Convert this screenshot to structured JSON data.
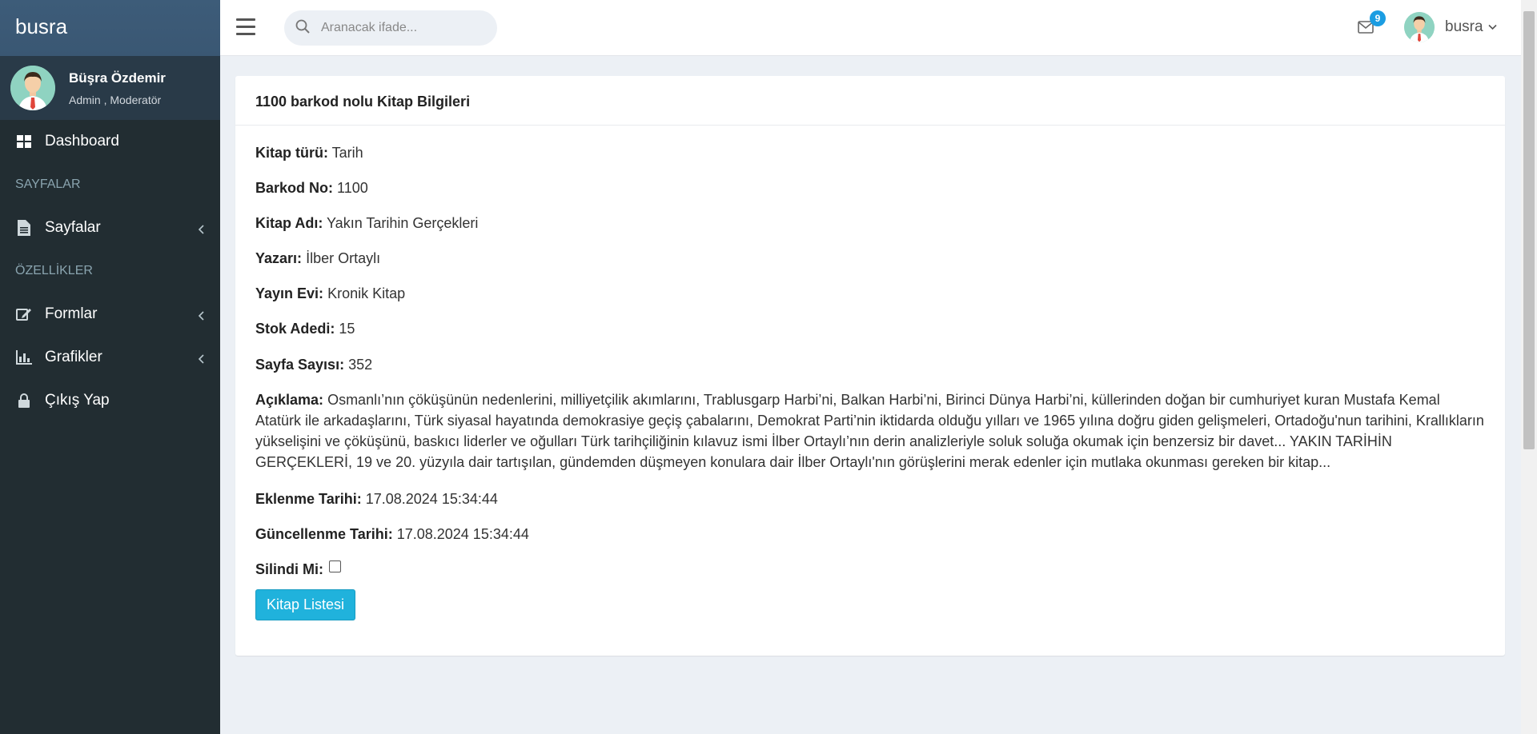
{
  "sidebar": {
    "brand": "busra",
    "user": {
      "name": "Büşra Özdemir",
      "role": "Admin , Moderatör"
    },
    "dashboard": "Dashboard",
    "header_pages": "SAYFALAR",
    "pages": "Sayfalar",
    "header_features": "ÖZELLİKLER",
    "forms": "Formlar",
    "charts": "Grafikler",
    "logout": "Çıkış Yap"
  },
  "topbar": {
    "search_placeholder": "Aranacak ifade...",
    "mail_count": "9",
    "username": "busra"
  },
  "card": {
    "title": "1100 barkod nolu Kitap Bilgileri",
    "fields": [
      {
        "label": "Kitap türü:",
        "value": "Tarih"
      },
      {
        "label": "Barkod No:",
        "value": "1100"
      },
      {
        "label": "Kitap Adı:",
        "value": "Yakın Tarihin Gerçekleri"
      },
      {
        "label": "Yazarı:",
        "value": "İlber Ortaylı"
      },
      {
        "label": "Yayın Evi:",
        "value": "Kronik Kitap"
      },
      {
        "label": "Stok Adedi:",
        "value": "15"
      },
      {
        "label": "Sayfa Sayısı:",
        "value": "352"
      }
    ],
    "description_label": "Açıklama:",
    "description": "Osmanlı’nın çöküşünün nedenlerini, milliyetçilik akımlarını, Trablusgarp Harbi’ni, Balkan Harbi’ni, Birinci Dünya Harbi’ni, küllerinden doğan bir cumhuriyet kuran Mustafa Kemal Atatürk ile arkadaşlarını, Türk siyasal hayatında demokrasiye geçiş çabalarını, Demokrat Parti’nin iktidarda olduğu yılları ve 1965 yılına doğru giden gelişmeleri, Ortadoğu'nun tarihini, Krallıkların yükselişini ve çöküşünü, baskıcı liderler ve oğulları Türk tarihçiliğinin kılavuz ismi İlber Ortaylı’nın derin analizleriyle soluk soluğa okumak için benzersiz bir davet... YAKIN TARİHİN GERÇEKLERİ, 19 ve 20. yüzyıla dair tartışılan, gündemden düşmeyen konulara dair İlber Ortaylı'nın görüşlerini merak edenler için mutlaka okunması gereken bir kitap...",
    "created_label": "Eklenme Tarihi:",
    "created": "17.08.2024 15:34:44",
    "updated_label": "Güncellenme Tarihi:",
    "updated": "17.08.2024 15:34:44",
    "deleted_label": "Silindi Mi:",
    "deleted": false,
    "button": "Kitap Listesi"
  },
  "colors": {
    "sidebar_bg": "#222d32",
    "brand_bg": "#3c5a78",
    "accent": "#20b2dc",
    "badge": "#1b9de2"
  }
}
